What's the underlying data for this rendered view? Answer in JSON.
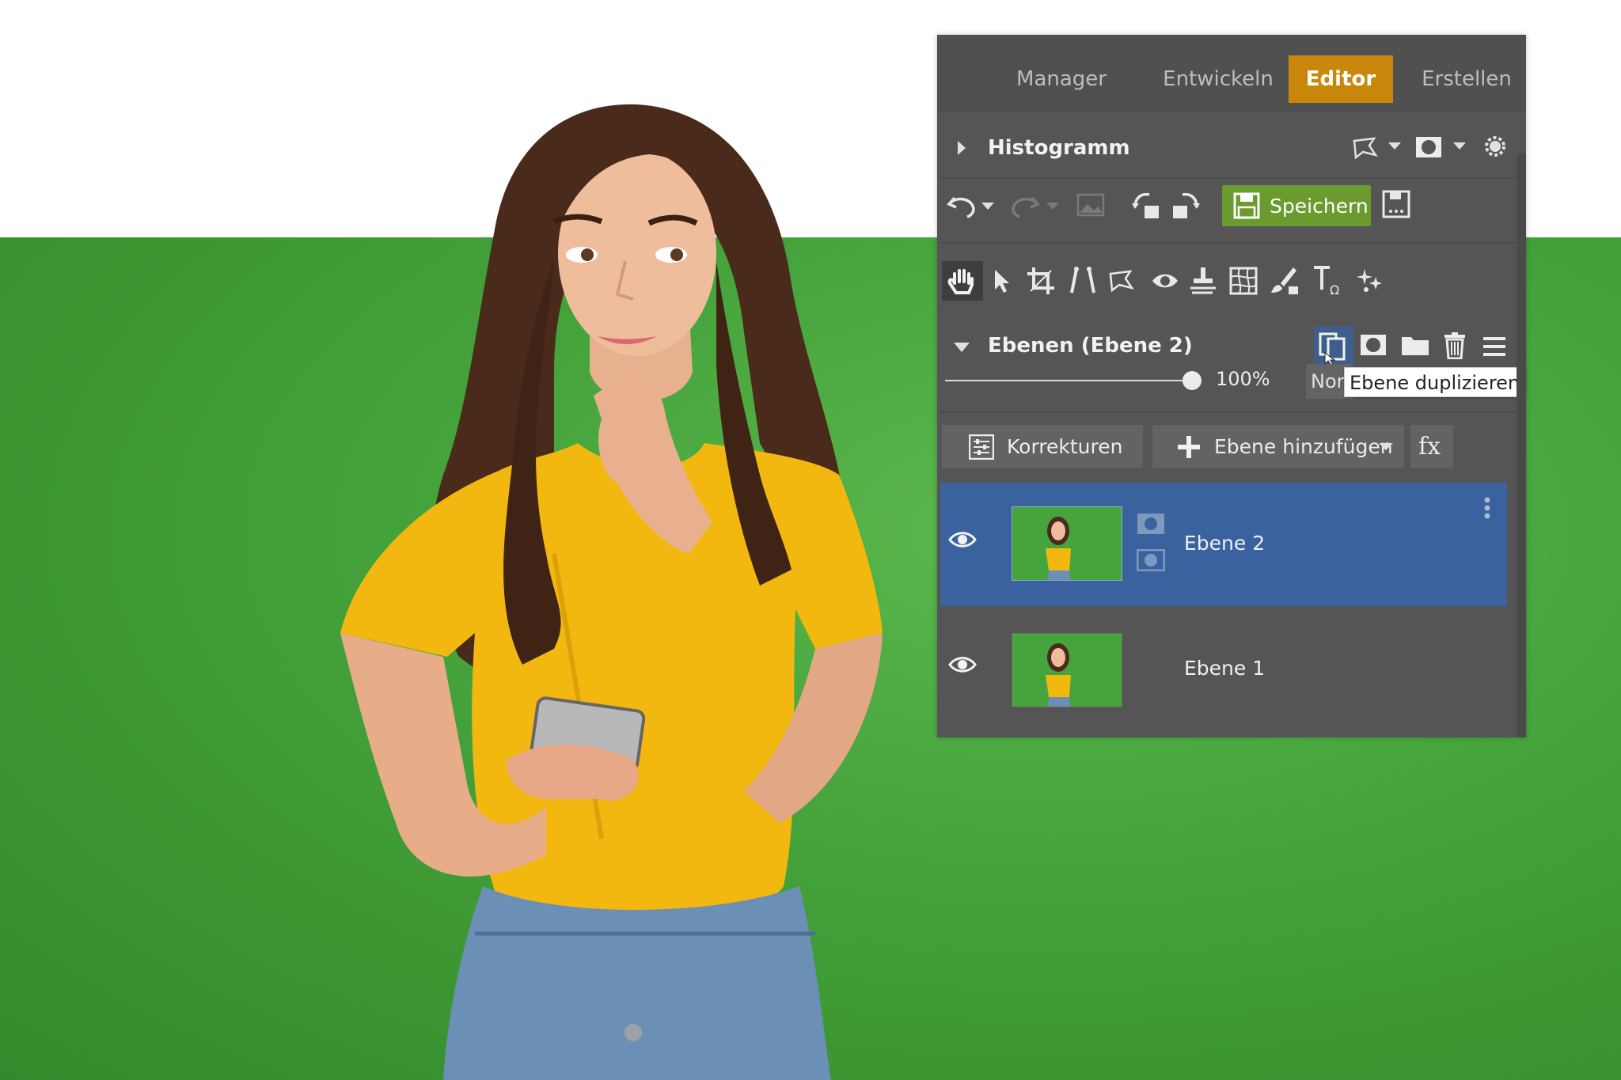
{
  "colors": {
    "panel_bg": "#555555",
    "active_tab": "#c8870b",
    "save_button": "#6b9a2e",
    "selected_layer": "#3a629e",
    "backdrop_green": "#46a43c",
    "shirt_yellow": "#f3b80f"
  },
  "tabs": [
    {
      "label": "Manager",
      "active": false
    },
    {
      "label": "Entwickeln",
      "active": false
    },
    {
      "label": "Editor",
      "active": true
    },
    {
      "label": "Erstellen",
      "active": false
    }
  ],
  "histogram": {
    "title": "Histogramm",
    "expanded": false,
    "icons": [
      "selection-icon",
      "dropdown-arrow-icon",
      "mask-icon",
      "dropdown-arrow-icon",
      "settings-icon"
    ]
  },
  "toolbar": {
    "icons": [
      "undo-icon",
      "undo-dropdown-icon",
      "redo-icon",
      "redo-dropdown-icon",
      "image-icon",
      "rotate-left-icon",
      "rotate-right-icon"
    ],
    "save_label": "Speichern",
    "save_as_icon": "save-as-icon"
  },
  "tools": [
    "hand-tool-icon",
    "pointer-tool-icon",
    "crop-tool-icon",
    "perspective-tool-icon",
    "selection-tool-icon",
    "redeye-tool-icon",
    "clone-tool-icon",
    "transform-grid-icon",
    "brush-tool-icon",
    "text-tool-icon",
    "effects-tool-icon"
  ],
  "layers_panel": {
    "title": "Ebenen (Ebene 2)",
    "expanded": true,
    "header_icons": [
      "duplicate-layer-icon",
      "mask-icon",
      "folder-icon",
      "trash-icon",
      "menu-icon"
    ],
    "opacity": "100%",
    "opacity_value": 1.0,
    "blend_mode_visible": "Nor",
    "tooltip": "Ebene duplizieren",
    "buttons": {
      "corrections": "Korrekturen",
      "add_layer": "Ebene hinzufügen",
      "fx": "fx"
    },
    "layers": [
      {
        "name": "Ebene 2",
        "visible": true,
        "selected": true
      },
      {
        "name": "Ebene 1",
        "visible": true,
        "selected": false
      }
    ]
  }
}
